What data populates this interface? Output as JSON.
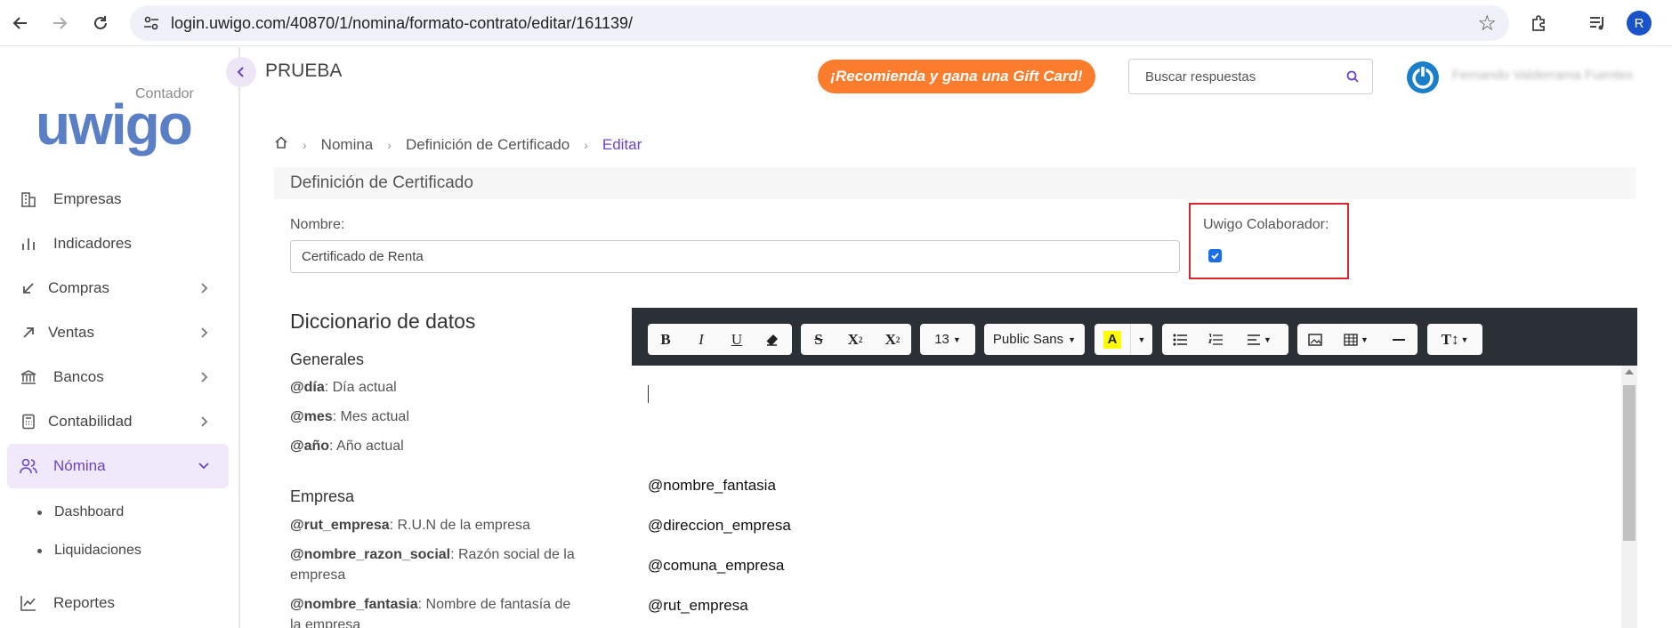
{
  "browser": {
    "url": "login.uwigo.com/40870/1/nomina/formato-contrato/editar/161139/",
    "profile_initial": "R"
  },
  "logo": {
    "brand": "uwigo",
    "tagline": "Contador"
  },
  "sidebar": {
    "items": [
      {
        "label": "Empresas",
        "icon": "building-icon"
      },
      {
        "label": "Indicadores",
        "icon": "bar-chart-icon"
      },
      {
        "label": "Compras",
        "icon": "arrow-down-left-icon"
      },
      {
        "label": "Ventas",
        "icon": "arrow-up-right-icon"
      },
      {
        "label": "Bancos",
        "icon": "bank-icon"
      },
      {
        "label": "Contabilidad",
        "icon": "calculator-icon"
      },
      {
        "label": "Nómina",
        "icon": "users-icon"
      },
      {
        "label": "Reportes",
        "icon": "line-chart-icon"
      }
    ],
    "subitems": [
      "Dashboard",
      "Liquidaciones"
    ]
  },
  "header": {
    "company": "PRUEBA",
    "promo": "¡Recomienda y gana una Gift Card!",
    "search_placeholder": "Buscar respuestas",
    "user_name": "Fernando Valderrama Fuentes"
  },
  "breadcrumb": {
    "items": [
      "Nomina",
      "Definición de Certificado"
    ],
    "current": "Editar"
  },
  "form": {
    "card_title": "Definición de Certificado",
    "name_label": "Nombre:",
    "name_value": "Certificado de Renta",
    "collab_label": "Uwigo Colaborador:",
    "collab_checked": true
  },
  "dictionary": {
    "title": "Diccionario de datos",
    "sections": [
      {
        "title": "Generales",
        "entries": [
          {
            "key": "@día",
            "desc": ": Día actual"
          },
          {
            "key": "@mes",
            "desc": ": Mes actual"
          },
          {
            "key": "@año",
            "desc": ": Año actual"
          }
        ]
      },
      {
        "title": "Empresa",
        "entries": [
          {
            "key": "@rut_empresa",
            "desc": ": R.U.N de la empresa"
          },
          {
            "key": "@nombre_razon_social",
            "desc": ": Razón social de la empresa"
          },
          {
            "key": "@nombre_fantasia",
            "desc": ": Nombre de fantasía de la empresa"
          }
        ]
      }
    ]
  },
  "editor": {
    "font_size": "13",
    "font_name": "Public Sans",
    "highlight_color": "#ffff00",
    "lines": [
      "@nombre_fantasia",
      "@direccion_empresa",
      "@comuna_empresa",
      "@rut_empresa"
    ]
  }
}
